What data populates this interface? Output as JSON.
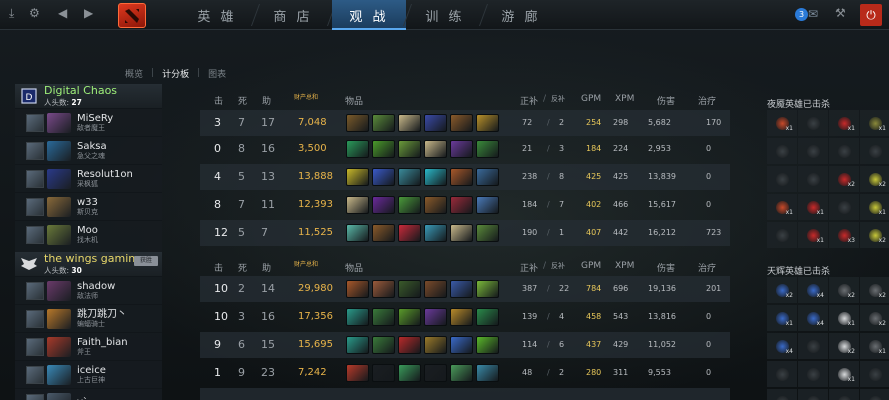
{
  "nav": {
    "tabs": [
      "英 雄",
      "商 店",
      "观 战",
      "训 练",
      "游 廊"
    ],
    "active_index": 2,
    "notification_count": "3"
  },
  "subnav": {
    "items": [
      "概览",
      "计分板",
      "图表"
    ],
    "active_index": 1
  },
  "headers": {
    "kills": "击",
    "deaths": "死",
    "assists": "助",
    "networth": "财产总和",
    "items": "物品",
    "lasthits": "正补",
    "denies": "反补",
    "gpm": "GPM",
    "xpm": "XPM",
    "damage": "伤害",
    "heal": "治疗"
  },
  "teams": [
    {
      "name": "Digital Chaos",
      "kills_label": "人头数:",
      "kills": "27",
      "winner_label": "",
      "name_color": "#9ff07a",
      "players": [
        {
          "name": "MiSeRy",
          "real": "敌者魔王",
          "k": "3",
          "d": "7",
          "a": "17",
          "nw": "7,048",
          "lh": "72",
          "dn": "2",
          "gpm": "254",
          "xpm": "298",
          "dmg": "5,682",
          "heal": "170",
          "hero_color": "#7a4a8a",
          "items": [
            "#7a5a2a",
            "#5a8a3a",
            "#c8b88a",
            "#3a4aa8",
            "#8a5a2a",
            "#b8902a"
          ]
        },
        {
          "name": "Saksa",
          "real": "急父之魂",
          "k": "0",
          "d": "8",
          "a": "16",
          "nw": "3,500",
          "lh": "21",
          "dn": "3",
          "gpm": "184",
          "xpm": "224",
          "dmg": "2,953",
          "heal": "0",
          "hero_color": "#2a6a9a",
          "items": [
            "#2a9a5a",
            "#4a9a2a",
            "#6a9a3a",
            "#c8b88a",
            "#6a3a9a",
            "#3a8a3a"
          ]
        },
        {
          "name": "Resolut1on",
          "real": "采枫狐",
          "k": "4",
          "d": "5",
          "a": "13",
          "nw": "13,888",
          "lh": "238",
          "dn": "8",
          "gpm": "425",
          "xpm": "425",
          "dmg": "13,839",
          "heal": "0",
          "hero_color": "#2a3a8a",
          "items": [
            "#c8b82a",
            "#3a5ac8",
            "#3a8a9a",
            "#2ab8c8",
            "#a8582a",
            "#3a6a9a"
          ]
        },
        {
          "name": "w33",
          "real": "斯贝克",
          "k": "8",
          "d": "7",
          "a": "11",
          "nw": "12,393",
          "lh": "184",
          "dn": "7",
          "gpm": "402",
          "xpm": "466",
          "dmg": "15,617",
          "heal": "0",
          "hero_color": "#8a6a3a",
          "items": [
            "#c8b88a",
            "#6a2a9a",
            "#4a9a3a",
            "#8a5a2a",
            "#9a2a3a",
            "#4a7ab8"
          ]
        },
        {
          "name": "Moo",
          "real": "找木机",
          "k": "12",
          "d": "5",
          "a": "7",
          "nw": "11,525",
          "lh": "190",
          "dn": "1",
          "gpm": "407",
          "xpm": "442",
          "dmg": "16,212",
          "heal": "723",
          "hero_color": "#6a7a3a",
          "items": [
            "#5ab8a8",
            "#8a5a2a",
            "#c82a3a",
            "#3a9ab8",
            "#c8b88a",
            "#5a8a3a"
          ]
        }
      ]
    },
    {
      "name": "the wings gaming",
      "kills_label": "人头数:",
      "kills": "30",
      "winner_label": "获胜",
      "name_color": "#e8d86a",
      "players": [
        {
          "name": "shadow",
          "real": "敌法师",
          "k": "10",
          "d": "2",
          "a": "14",
          "nw": "29,980",
          "lh": "387",
          "dn": "22",
          "gpm": "784",
          "xpm": "696",
          "dmg": "19,136",
          "heal": "201",
          "hero_color": "#6a3a6a",
          "items": [
            "#a8582a",
            "#9a5a3a",
            "#3a5a2a",
            "#7a4a2a",
            "#3a5aa8",
            "#7ab83a"
          ]
        },
        {
          "name": "跳刀跳刀丶",
          "real": "蝙蝠骑士",
          "k": "10",
          "d": "3",
          "a": "16",
          "nw": "17,356",
          "lh": "139",
          "dn": "4",
          "gpm": "458",
          "xpm": "543",
          "dmg": "13,816",
          "heal": "0",
          "hero_color": "#b8782a",
          "items": [
            "#2a9a8a",
            "#3a7a3a",
            "#5a9a2a",
            "#6a3a9a",
            "#b88a2a",
            "#2a8a4a"
          ]
        },
        {
          "name": "Faith_bian",
          "real": "斧王",
          "k": "9",
          "d": "6",
          "a": "15",
          "nw": "15,695",
          "lh": "114",
          "dn": "6",
          "gpm": "437",
          "xpm": "429",
          "dmg": "11,052",
          "heal": "0",
          "hero_color": "#a83a2a",
          "items": [
            "#2a9a8a",
            "#3a7a3a",
            "#b82a2a",
            "#9a7a2a",
            "#3a6ac8",
            "#5ab82a"
          ]
        },
        {
          "name": "iceice",
          "real": "上古巨神",
          "k": "1",
          "d": "9",
          "a": "23",
          "nw": "7,242",
          "lh": "48",
          "dn": "2",
          "gpm": "280",
          "xpm": "311",
          "dmg": "9,553",
          "heal": "0",
          "hero_color": "#3a8ab8",
          "items": [
            "#b83a2a",
            "#1a1e22",
            "#3a9a5a",
            "#1a1e22",
            "#4a9a5a",
            "#3a8aa8"
          ]
        },
        {
          "name": "y`",
          "real": "",
          "k": "",
          "d": "",
          "a": "",
          "nw": "",
          "lh": "",
          "dn": "",
          "gpm": "",
          "xpm": "",
          "dmg": "",
          "heal": "",
          "hero_color": "#4a5a6a",
          "items": []
        }
      ]
    }
  ],
  "right_panel": {
    "dire_title": "夜魇英雄已击杀",
    "radiant_title": "天辉英雄已击杀",
    "dire_kills": [
      [
        {
          "c": "#c84a2a",
          "n": "x1"
        },
        {
          "c": "#3a4044",
          "n": ""
        },
        {
          "c": "#c82a2a",
          "n": "x1"
        },
        {
          "c": "#8a8a3a",
          "n": "x1"
        }
      ],
      [
        {
          "c": "#3a4044",
          "n": ""
        },
        {
          "c": "#3a4044",
          "n": ""
        },
        {
          "c": "#3a4044",
          "n": ""
        },
        {
          "c": "#3a4044",
          "n": ""
        }
      ],
      [
        {
          "c": "#3a4044",
          "n": ""
        },
        {
          "c": "#3a4044",
          "n": ""
        },
        {
          "c": "#c82a2a",
          "n": "x2"
        },
        {
          "c": "#c8c83a",
          "n": "x2"
        }
      ],
      [
        {
          "c": "#c84a2a",
          "n": "x1"
        },
        {
          "c": "#c82a2a",
          "n": "x1"
        },
        {
          "c": "#3a4044",
          "n": ""
        },
        {
          "c": "#c8c83a",
          "n": "x1"
        }
      ],
      [
        {
          "c": "#3a4044",
          "n": ""
        },
        {
          "c": "#c82a2a",
          "n": "x1"
        },
        {
          "c": "#c82a2a",
          "n": "x3"
        },
        {
          "c": "#c8c83a",
          "n": "x2"
        }
      ]
    ],
    "radiant_kills": [
      [
        {
          "c": "#3a6ac8",
          "n": "x2"
        },
        {
          "c": "#3a6ac8",
          "n": "x4"
        },
        {
          "c": "#6a6e72",
          "n": "x2"
        },
        {
          "c": "#6a6e72",
          "n": "x2"
        }
      ],
      [
        {
          "c": "#3a6ac8",
          "n": "x1"
        },
        {
          "c": "#3a6ac8",
          "n": "x4"
        },
        {
          "c": "#d8dadc",
          "n": "x1"
        },
        {
          "c": "#6a6e72",
          "n": "x2"
        }
      ],
      [
        {
          "c": "#3a6ac8",
          "n": "x4"
        },
        {
          "c": "#3a4044",
          "n": ""
        },
        {
          "c": "#d8dadc",
          "n": "x2"
        },
        {
          "c": "#6a6e72",
          "n": "x1"
        }
      ],
      [
        {
          "c": "#3a4044",
          "n": ""
        },
        {
          "c": "#3a4044",
          "n": ""
        },
        {
          "c": "#d8dadc",
          "n": "x1"
        },
        {
          "c": "#3a4044",
          "n": ""
        }
      ],
      [
        {
          "c": "#3a4044",
          "n": ""
        },
        {
          "c": "#3a4044",
          "n": ""
        },
        {
          "c": "#3a4044",
          "n": ""
        },
        {
          "c": "#3a4044",
          "n": ""
        }
      ]
    ]
  }
}
